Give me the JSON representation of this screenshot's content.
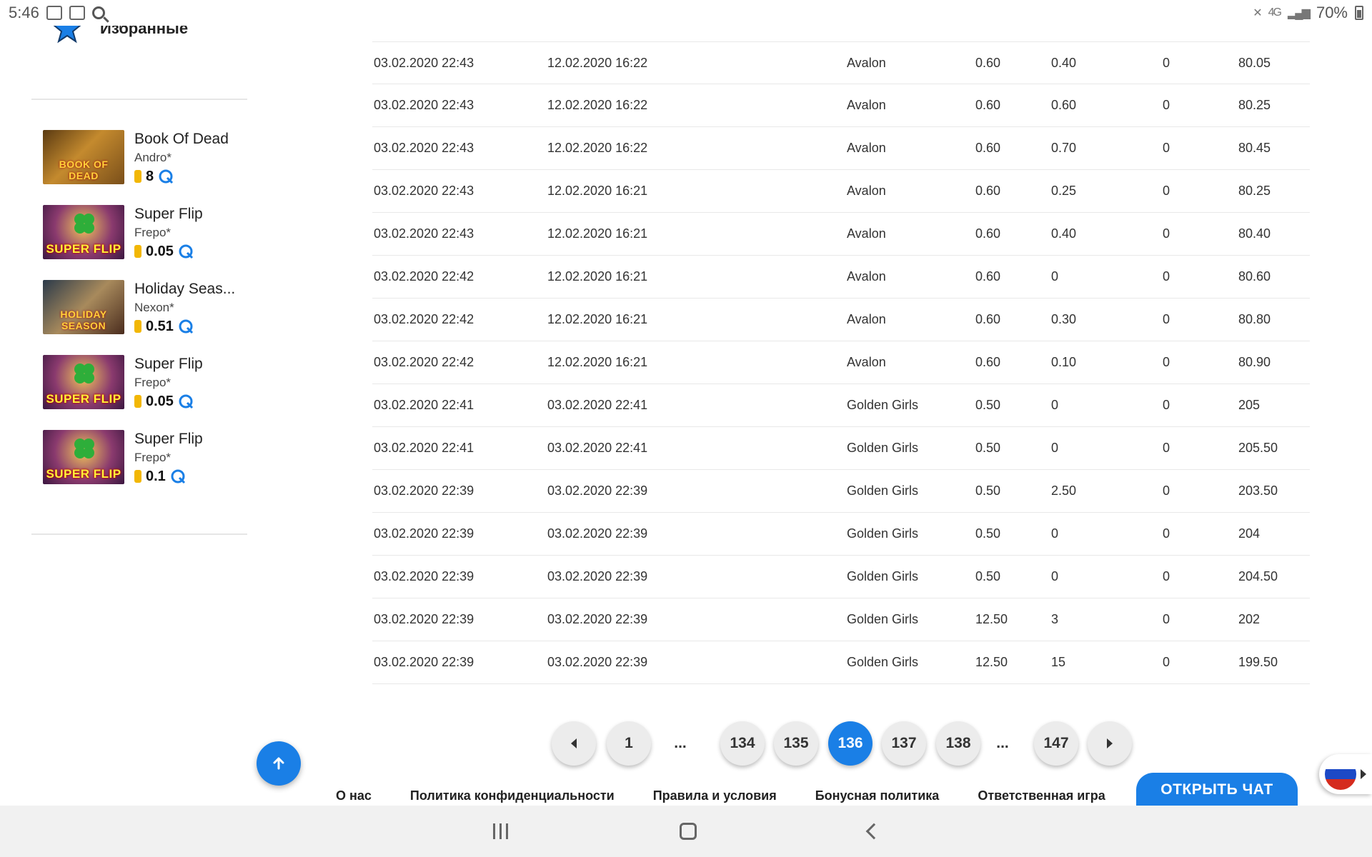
{
  "status_bar": {
    "time": "5:46",
    "battery": "70%",
    "network": "4G"
  },
  "sidebar": {
    "title": "Избранные",
    "games": [
      {
        "name": "Book Of Dead",
        "provider": "Andro*",
        "value": "8",
        "thumb_text": "BOOK OF DEAD"
      },
      {
        "name": "Super Flip",
        "provider": "Frepo*",
        "value": "0.05",
        "thumb_text": "SUPER FLIP"
      },
      {
        "name": "Holiday Seas...",
        "provider": "Nexon*",
        "value": "0.51",
        "thumb_text": "HOLIDAY SEASON"
      },
      {
        "name": "Super Flip",
        "provider": "Frepo*",
        "value": "0.05",
        "thumb_text": "SUPER FLIP"
      },
      {
        "name": "Super Flip",
        "provider": "Frepo*",
        "value": "0.1",
        "thumb_text": "SUPER FLIP"
      }
    ]
  },
  "table": {
    "rows": [
      [
        "03.02.2020 22:43",
        "12.02.2020 16:22",
        "Avalon",
        "0.60",
        "0.40",
        "0",
        "80.05"
      ],
      [
        "03.02.2020 22:43",
        "12.02.2020 16:22",
        "Avalon",
        "0.60",
        "0.60",
        "0",
        "80.25"
      ],
      [
        "03.02.2020 22:43",
        "12.02.2020 16:22",
        "Avalon",
        "0.60",
        "0.70",
        "0",
        "80.45"
      ],
      [
        "03.02.2020 22:43",
        "12.02.2020 16:21",
        "Avalon",
        "0.60",
        "0.25",
        "0",
        "80.25"
      ],
      [
        "03.02.2020 22:43",
        "12.02.2020 16:21",
        "Avalon",
        "0.60",
        "0.40",
        "0",
        "80.40"
      ],
      [
        "03.02.2020 22:42",
        "12.02.2020 16:21",
        "Avalon",
        "0.60",
        "0",
        "0",
        "80.60"
      ],
      [
        "03.02.2020 22:42",
        "12.02.2020 16:21",
        "Avalon",
        "0.60",
        "0.30",
        "0",
        "80.80"
      ],
      [
        "03.02.2020 22:42",
        "12.02.2020 16:21",
        "Avalon",
        "0.60",
        "0.10",
        "0",
        "80.90"
      ],
      [
        "03.02.2020 22:41",
        "03.02.2020 22:41",
        "Golden Girls",
        "0.50",
        "0",
        "0",
        "205"
      ],
      [
        "03.02.2020 22:41",
        "03.02.2020 22:41",
        "Golden Girls",
        "0.50",
        "0",
        "0",
        "205.50"
      ],
      [
        "03.02.2020 22:39",
        "03.02.2020 22:39",
        "Golden Girls",
        "0.50",
        "2.50",
        "0",
        "203.50"
      ],
      [
        "03.02.2020 22:39",
        "03.02.2020 22:39",
        "Golden Girls",
        "0.50",
        "0",
        "0",
        "204"
      ],
      [
        "03.02.2020 22:39",
        "03.02.2020 22:39",
        "Golden Girls",
        "0.50",
        "0",
        "0",
        "204.50"
      ],
      [
        "03.02.2020 22:39",
        "03.02.2020 22:39",
        "Golden Girls",
        "12.50",
        "3",
        "0",
        "202"
      ],
      [
        "03.02.2020 22:39",
        "03.02.2020 22:39",
        "Golden Girls",
        "12.50",
        "15",
        "0",
        "199.50"
      ]
    ]
  },
  "pagination": {
    "items": [
      {
        "type": "prev",
        "label": ""
      },
      {
        "type": "page",
        "label": "1"
      },
      {
        "type": "ellipsis",
        "label": "..."
      },
      {
        "type": "page",
        "label": "134"
      },
      {
        "type": "page",
        "label": "135"
      },
      {
        "type": "page",
        "label": "136",
        "active": true
      },
      {
        "type": "page",
        "label": "137"
      },
      {
        "type": "page",
        "label": "138"
      },
      {
        "type": "ellipsis",
        "label": "..."
      },
      {
        "type": "page",
        "label": "147"
      },
      {
        "type": "next",
        "label": ""
      }
    ]
  },
  "footer": {
    "links": [
      "О нас",
      "Политика конфиденциальности",
      "Правила и условия",
      "Бонусная политика",
      "Ответственная игра"
    ],
    "chat_label": "ОТКРЫТЬ ЧАТ"
  },
  "colors": {
    "accent": "#1a7fe6",
    "coin": "#f2b705"
  },
  "icons": {
    "favorites": "star-icon",
    "scroll_top": "arrow-up-icon",
    "rtp": "rtp-icon",
    "coin": "coin-icon"
  }
}
